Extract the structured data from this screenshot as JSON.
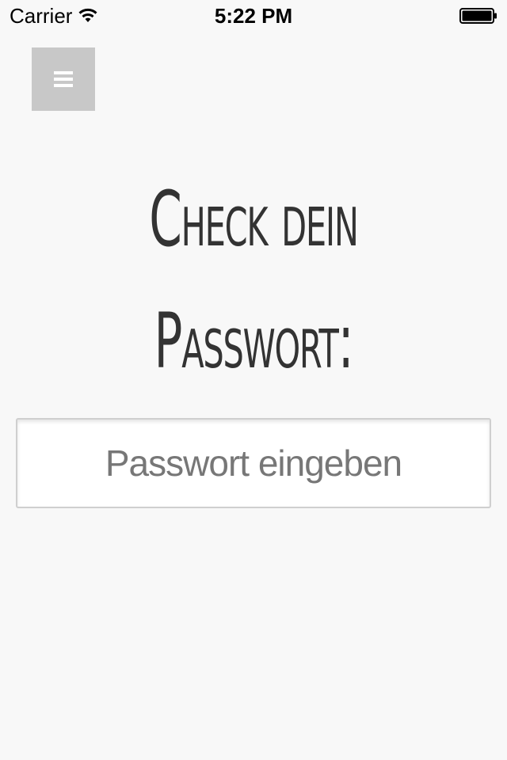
{
  "status_bar": {
    "carrier": "Carrier",
    "time": "5:22 PM",
    "wifi_icon": "wifi-icon",
    "battery_icon": "battery-full-icon"
  },
  "header": {
    "menu_icon": "hamburger-menu-icon",
    "menu_button_color": "#c8c8c8"
  },
  "main": {
    "title_line_1": "Check dein",
    "title_line_2": "Passwort:",
    "password_input": {
      "value": "",
      "placeholder": "Passwort eingeben"
    }
  },
  "colors": {
    "background": "#f8f8f8",
    "text": "#333333",
    "placeholder": "#777777"
  }
}
